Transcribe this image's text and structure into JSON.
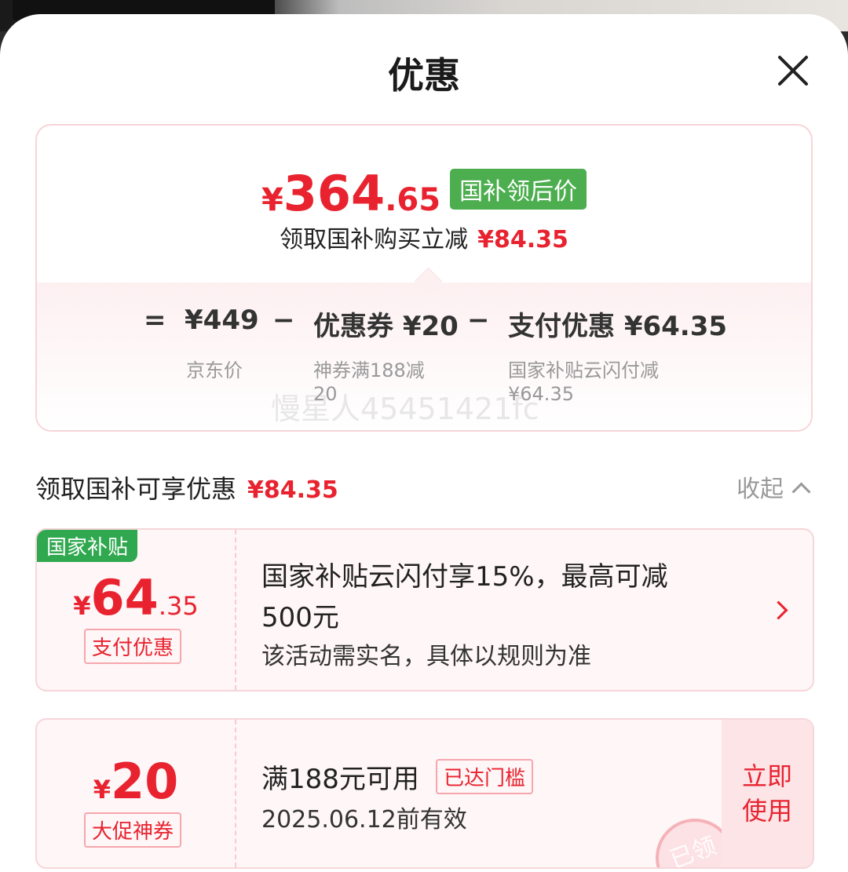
{
  "sheet": {
    "title": "优惠"
  },
  "summary": {
    "price_currency": "¥",
    "price_int": "364",
    "price_dec": ".65",
    "price_tag": "国补领后价",
    "sub_text": "领取国补购买立减",
    "sub_amount": "¥84.35",
    "calc": {
      "eq": "=",
      "jd_price": "¥449",
      "jd_price_label": "京东价",
      "minus1": "−",
      "coupon": "优惠券 ¥20",
      "coupon_desc_line1": "神券满188减",
      "coupon_desc_line2": "20",
      "minus2": "−",
      "pay": "支付优惠 ¥64.35",
      "pay_desc_line1": "国家补贴云闪付减",
      "pay_desc_line2": "¥64.35"
    },
    "watermark": "慢星人45451421fc"
  },
  "section": {
    "title": "领取国补可享优惠",
    "amount": "¥84.35",
    "collapse_label": "收起"
  },
  "card1": {
    "badge": "国家补贴",
    "currency": "¥",
    "amount_int": "64",
    "amount_dec": ".35",
    "tag": "支付优惠",
    "line1": "国家补贴云闪付享15%，最高可减",
    "line2": "500元",
    "line3": "该活动需实名，具体以规则为准"
  },
  "card2": {
    "currency": "¥",
    "amount_int": "20",
    "tag": "大促神券",
    "condition": "满188元可用",
    "status_tag": "已达门槛",
    "valid": "2025.06.12前有效",
    "use_line1": "立即",
    "use_line2": "使用",
    "stamp": "已领"
  },
  "colors": {
    "accent_red": "#e8232f",
    "green": "#4cae4f"
  }
}
